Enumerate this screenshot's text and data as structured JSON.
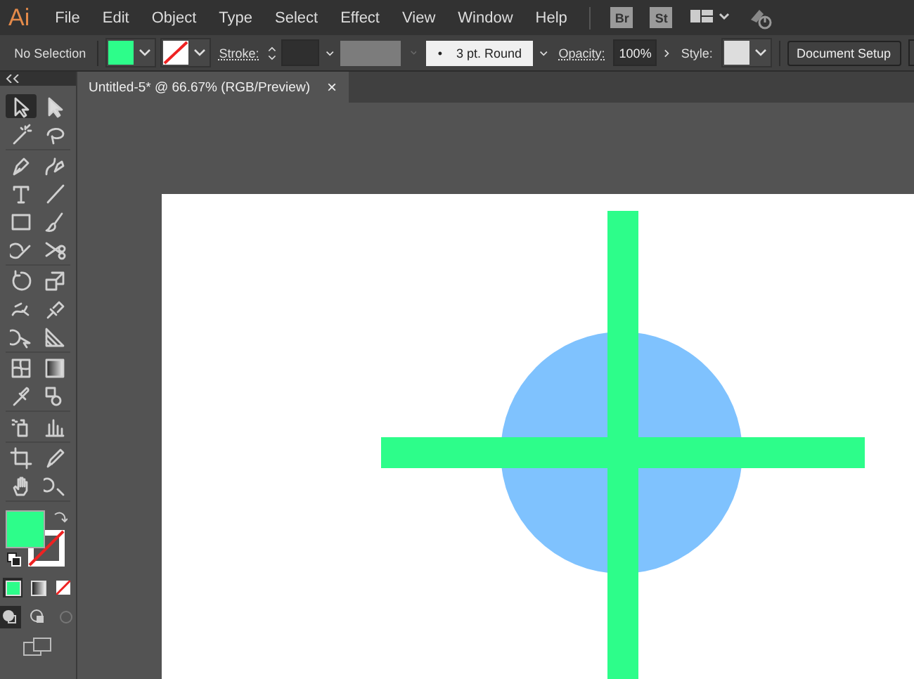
{
  "app_logo": "Ai",
  "menu": [
    "File",
    "Edit",
    "Object",
    "Type",
    "Select",
    "Effect",
    "View",
    "Window",
    "Help"
  ],
  "app_buttons": [
    "Br",
    "St"
  ],
  "control_bar": {
    "selection_status": "No Selection",
    "stroke_label": "Stroke:",
    "brush_bullet": "•",
    "brush": "3 pt. Round",
    "opacity_label": "Opacity:",
    "opacity": "100%",
    "style_label": "Style:",
    "document_setup": "Document Setup"
  },
  "document_tab": {
    "title": "Untitled-5* @ 66.67% (RGB/Preview)",
    "close": "×"
  },
  "tool_groups": [
    [
      {
        "kind": "selection",
        "selected": true
      },
      {
        "kind": "direct",
        "selected": false
      },
      {
        "kind": "wand",
        "selected": false
      },
      {
        "kind": "lasso",
        "selected": false
      }
    ],
    [
      {
        "kind": "pen",
        "selected": false
      },
      {
        "kind": "curvature",
        "selected": false
      },
      {
        "kind": "type",
        "selected": false
      },
      {
        "kind": "line",
        "selected": false
      },
      {
        "kind": "rectangle",
        "selected": false
      },
      {
        "kind": "brush",
        "selected": false
      },
      {
        "kind": "shaper",
        "selected": false
      },
      {
        "kind": "scissors",
        "selected": false
      }
    ],
    [
      {
        "kind": "rotate",
        "selected": false
      },
      {
        "kind": "scale",
        "selected": false
      },
      {
        "kind": "warp",
        "selected": false
      },
      {
        "kind": "pin",
        "selected": false
      },
      {
        "kind": "builder",
        "selected": false
      },
      {
        "kind": "perspective",
        "selected": false
      }
    ],
    [
      {
        "kind": "mesh",
        "selected": false
      },
      {
        "kind": "gradient",
        "selected": false
      },
      {
        "kind": "eyedropper",
        "selected": false
      },
      {
        "kind": "blend",
        "selected": false
      }
    ],
    [
      {
        "kind": "sprayer",
        "selected": false
      },
      {
        "kind": "graph",
        "selected": false
      }
    ],
    [
      {
        "kind": "artboard",
        "selected": false
      },
      {
        "kind": "slice",
        "selected": false
      },
      {
        "kind": "hand",
        "selected": false
      },
      {
        "kind": "zoom",
        "selected": false
      }
    ]
  ]
}
